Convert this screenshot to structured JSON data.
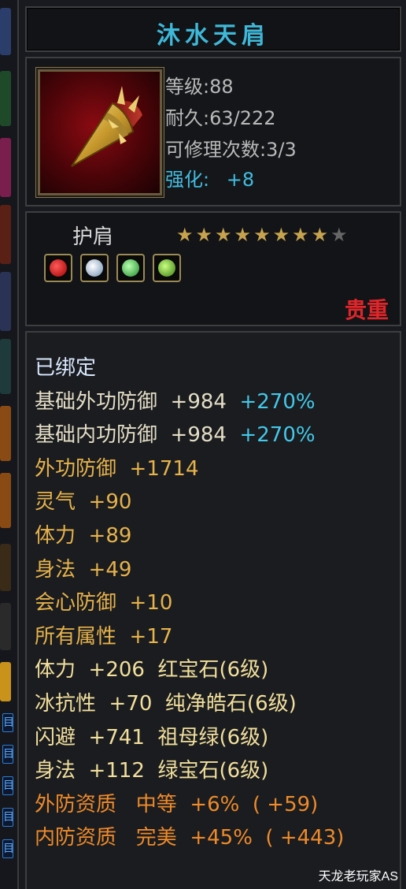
{
  "item": {
    "name": "沐水天肩",
    "level_line": "等级:88",
    "durability_line": "耐久:63/222",
    "repair_line": "可修理次数:3/3",
    "enhance_label": "强化:",
    "enhance_value": "+8"
  },
  "category": "护肩",
  "stars": {
    "filled": 8,
    "total": 9
  },
  "gems_icons": [
    "red-gem-icon",
    "white-gem-icon",
    "green-gem-icon",
    "emerald-gem-icon"
  ],
  "rarity": "贵重",
  "attributes": [
    {
      "text": "已绑定",
      "color": "#d9e8ff"
    },
    {
      "text": "基础外功防御  +984  ",
      "extra": "+270%",
      "color": "#e4ddc6",
      "extra_color": "#43c8e9"
    },
    {
      "text": "基础内功防御  +984  ",
      "extra": "+270%",
      "color": "#e4ddc6",
      "extra_color": "#43c8e9"
    },
    {
      "text": "外功防御  +1714",
      "color": "#e6b24b"
    },
    {
      "text": "灵气  +90",
      "color": "#e6b24b"
    },
    {
      "text": "体力  +89",
      "color": "#e6b24b"
    },
    {
      "text": "身法  +49",
      "color": "#e6b24b"
    },
    {
      "text": "会心防御  +10",
      "color": "#e6b24b"
    },
    {
      "text": "所有属性  +17",
      "color": "#e6b24b"
    },
    {
      "text": "体力  +206  红宝石(6级)",
      "color": "#f2df9c"
    },
    {
      "text": "冰抗性  +70  纯净皓石(6级)",
      "color": "#f2df9c"
    },
    {
      "text": "闪避  +741  祖母绿(6级)",
      "color": "#f2df9c"
    },
    {
      "text": "身法  +112  绿宝石(6级)",
      "color": "#f2df9c"
    },
    {
      "text": "外防资质   中等  +6%  ( +59)",
      "color": "#ee8a2a"
    },
    {
      "text": "内防资质   完美  +45%  ( +443)",
      "color": "#ee8a2a"
    }
  ],
  "watermark": "天龙老玩家AS"
}
